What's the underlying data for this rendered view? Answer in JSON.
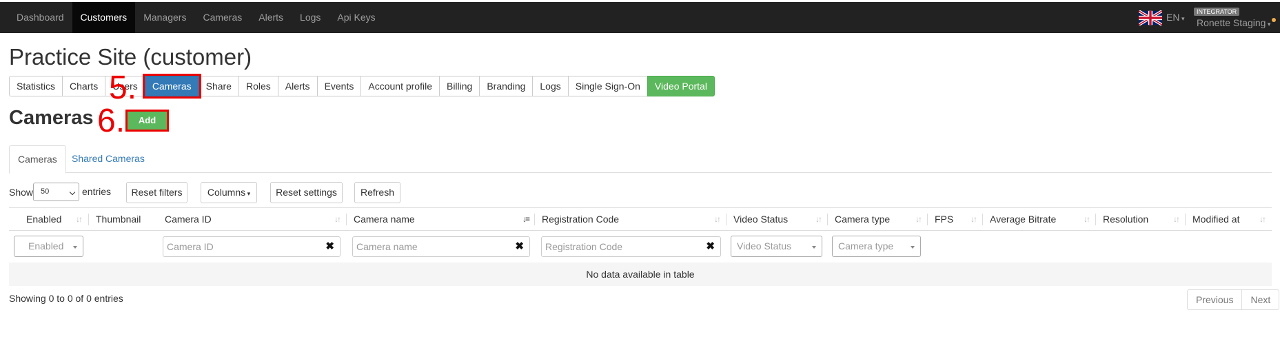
{
  "navbar": {
    "items": [
      {
        "label": "Dashboard"
      },
      {
        "label": "Customers"
      },
      {
        "label": "Managers"
      },
      {
        "label": "Cameras"
      },
      {
        "label": "Alerts"
      },
      {
        "label": "Logs"
      },
      {
        "label": "Api Keys"
      }
    ],
    "active": "Customers",
    "language": "EN",
    "role_badge": "INTEGRATOR",
    "user_name": "Ronette Staging",
    "flag_icon": "uk-flag-icon",
    "status_dot_color": "#f0ad4e"
  },
  "page": {
    "title": "Practice Site (customer)"
  },
  "subnav": {
    "items": [
      {
        "label": "Statistics"
      },
      {
        "label": "Charts"
      },
      {
        "label": "Users"
      },
      {
        "label": "Cameras"
      },
      {
        "label": "Share"
      },
      {
        "label": "Roles"
      },
      {
        "label": "Alerts"
      },
      {
        "label": "Events"
      },
      {
        "label": "Account profile"
      },
      {
        "label": "Billing"
      },
      {
        "label": "Branding"
      },
      {
        "label": "Logs"
      },
      {
        "label": "Single Sign-On"
      },
      {
        "label": "Video Portal"
      }
    ],
    "active": "Cameras"
  },
  "annotations": {
    "step5": "5.",
    "step6": "6."
  },
  "section": {
    "title": "Cameras",
    "add_label": "Add"
  },
  "tabs": [
    {
      "label": "Cameras"
    },
    {
      "label": "Shared Cameras"
    }
  ],
  "toolbar": {
    "show_label": "Show",
    "page_size": "50",
    "entries_label": "entries",
    "reset_filters": "Reset filters",
    "columns": "Columns",
    "reset_settings": "Reset settings",
    "refresh": "Refresh"
  },
  "table": {
    "columns": [
      {
        "label": "Enabled"
      },
      {
        "label": "Thumbnail"
      },
      {
        "label": "Camera ID"
      },
      {
        "label": "Camera name"
      },
      {
        "label": "Registration Code"
      },
      {
        "label": "Video Status"
      },
      {
        "label": "Camera type"
      },
      {
        "label": "FPS"
      },
      {
        "label": "Average Bitrate"
      },
      {
        "label": "Resolution"
      },
      {
        "label": "Modified at"
      }
    ],
    "filters": {
      "enabled_placeholder": "Enabled",
      "camera_id_placeholder": "Camera ID",
      "camera_name_placeholder": "Camera name",
      "registration_code_placeholder": "Registration Code",
      "video_status_placeholder": "Video Status",
      "camera_type_placeholder": "Camera type",
      "clear_glyph": "✖"
    },
    "empty_message": "No data available in table"
  },
  "footer": {
    "info": "Showing 0 to 0 of 0 entries",
    "previous": "Previous",
    "next": "Next"
  }
}
